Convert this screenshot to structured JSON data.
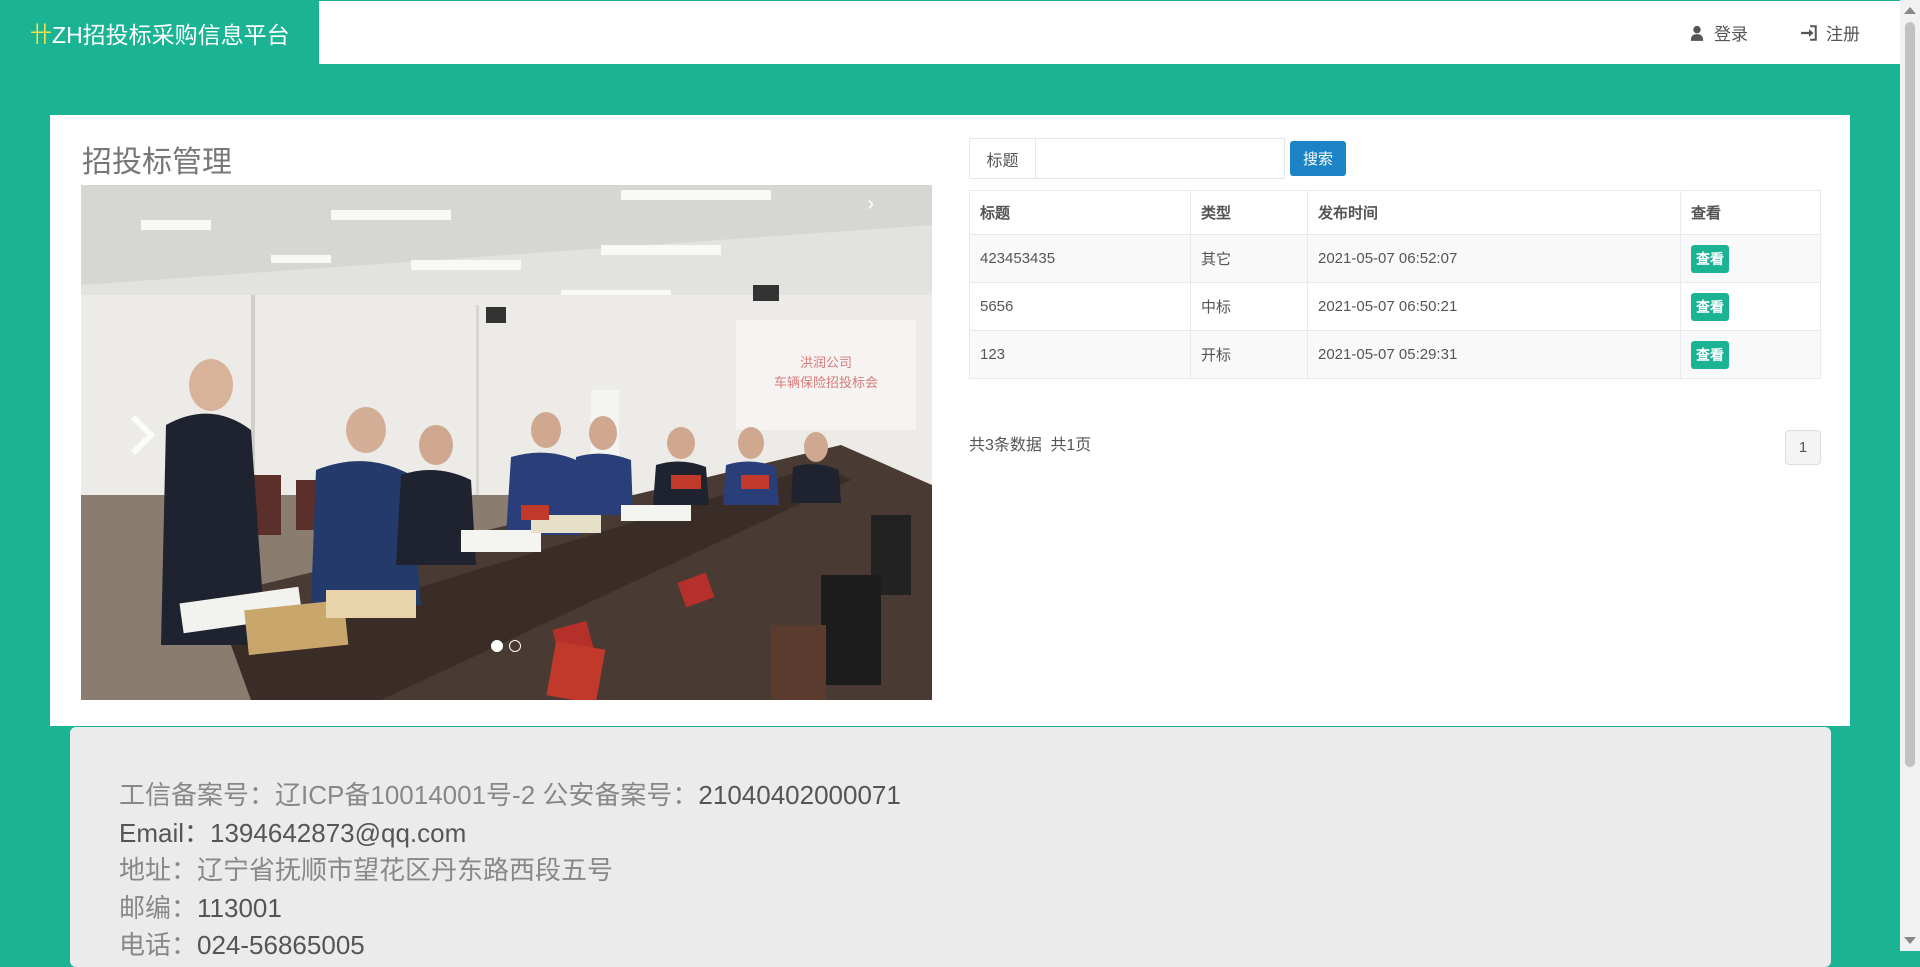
{
  "brand": {
    "logo_glyph": "卄",
    "name": "ZH招投标采购信息平台"
  },
  "nav": {
    "login": {
      "label": "登录",
      "icon": "user-icon"
    },
    "register": {
      "label": "注册",
      "icon": "sign-in-icon"
    }
  },
  "main": {
    "title": "招投标管理",
    "carousel": {
      "slide_count": 2,
      "active_index": 0,
      "prev_icon": "chevron-left-icon",
      "next_icon": "chevron-right-icon"
    },
    "search": {
      "label": "标题",
      "value": "",
      "placeholder": "",
      "button": "搜索"
    },
    "table": {
      "headers": [
        "标题",
        "类型",
        "发布时间",
        "查看"
      ],
      "rows": [
        {
          "title": "423453435",
          "type": "其它",
          "time": "2021-05-07 06:52:07",
          "action": "查看"
        },
        {
          "title": "5656",
          "type": "中标",
          "time": "2021-05-07 06:50:21",
          "action": "查看"
        },
        {
          "title": "123",
          "type": "开标",
          "time": "2021-05-07 05:29:31",
          "action": "查看"
        }
      ]
    },
    "pagination": {
      "total_records": "共3条数据",
      "total_pages": "共1页",
      "current_page": "1"
    }
  },
  "footer": {
    "icp_label": "工信备案号：",
    "icp_value": "辽ICP备10014001号-2",
    "police_label": "公安备案号：",
    "police_value": "21040402000071",
    "email_label": "Email：",
    "email_value": "1394642873@qq.com",
    "address_label": "地址：",
    "address_value": "辽宁省抚顺市望花区丹东路西段五号",
    "zip_label": "邮编：",
    "zip_value": "113001",
    "phone_label": "电话：",
    "phone_value": "024-56865005"
  },
  "colors": {
    "primary": "#1ab394",
    "search_button": "#1c84c6",
    "footer_bg": "#ebebeb"
  }
}
